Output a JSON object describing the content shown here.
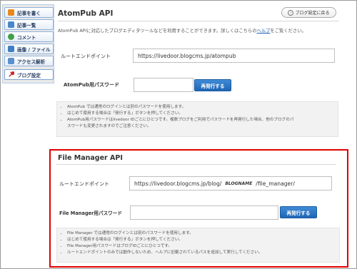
{
  "sidebar": {
    "items": [
      {
        "label": "記事を書く",
        "icon": "pencil-icon",
        "color": "#e58a1f"
      },
      {
        "label": "記事一覧",
        "icon": "list-icon",
        "color": "#4a86c8"
      },
      {
        "label": "コメント",
        "icon": "comment-icon",
        "color": "#43a047"
      },
      {
        "label": "画像 / ファイル",
        "icon": "image-icon",
        "color": "#3f7fc2"
      },
      {
        "label": "アクセス解析",
        "icon": "chart-icon",
        "color": "#5c8fcf"
      },
      {
        "label": "ブログ設定",
        "icon": "wrench-icon",
        "color": "#c62828"
      }
    ]
  },
  "header": {
    "title": "AtomPub API",
    "back_label": "ブログ設定に戻る",
    "description_prefix": "AtomPub APIに対応したブログエディタツールなどを利用することができます。詳しくはこちらの",
    "help_link": "ヘルプ",
    "description_suffix": "をご覧ください。"
  },
  "atompub": {
    "endpoint_label": "ルートエンドポイント",
    "endpoint_value": "https://livedoor.blogcms.jp/atompub",
    "password_label": "AtomPub用パスワード",
    "password_value": "",
    "reissue_label": "再発行する",
    "notes": [
      "AtomPub では通常のログインとは別のパスワードを使用します。",
      "はじめて使用する場合は「発行する」ボタンを押してください。",
      "AtomPub用パスワードはlivedoor IDごとにひとつです。複数ブログをご利用でパスワードを再発行した場合、他のブログのパ",
      "スワードも変更されますのでご注意ください。"
    ]
  },
  "file_manager": {
    "title": "File Manager API",
    "endpoint_label": "ルートエンドポイント",
    "endpoint_prefix": "https://livedoor.blogcms.jp/blog/",
    "endpoint_placeholder": "BLOGNAME",
    "endpoint_suffix": "/file_manager/",
    "password_label": "File Manager用パスワード",
    "password_value": "",
    "reissue_label": "再発行する",
    "notes": [
      "File Manager では通常のログインとは別のパスワードを使用します。",
      "はじめて使用する場合は「発行する」ボタンを押してください。",
      "File Manager用パスワードはブログIDごとにひとつです。",
      "ルートエンドポイントのみでは動作しないため、ヘルプに記載されているパスを追加して実行してください。"
    ]
  },
  "colors": {
    "accent": "#1f66b5",
    "highlight": "#e00000"
  }
}
